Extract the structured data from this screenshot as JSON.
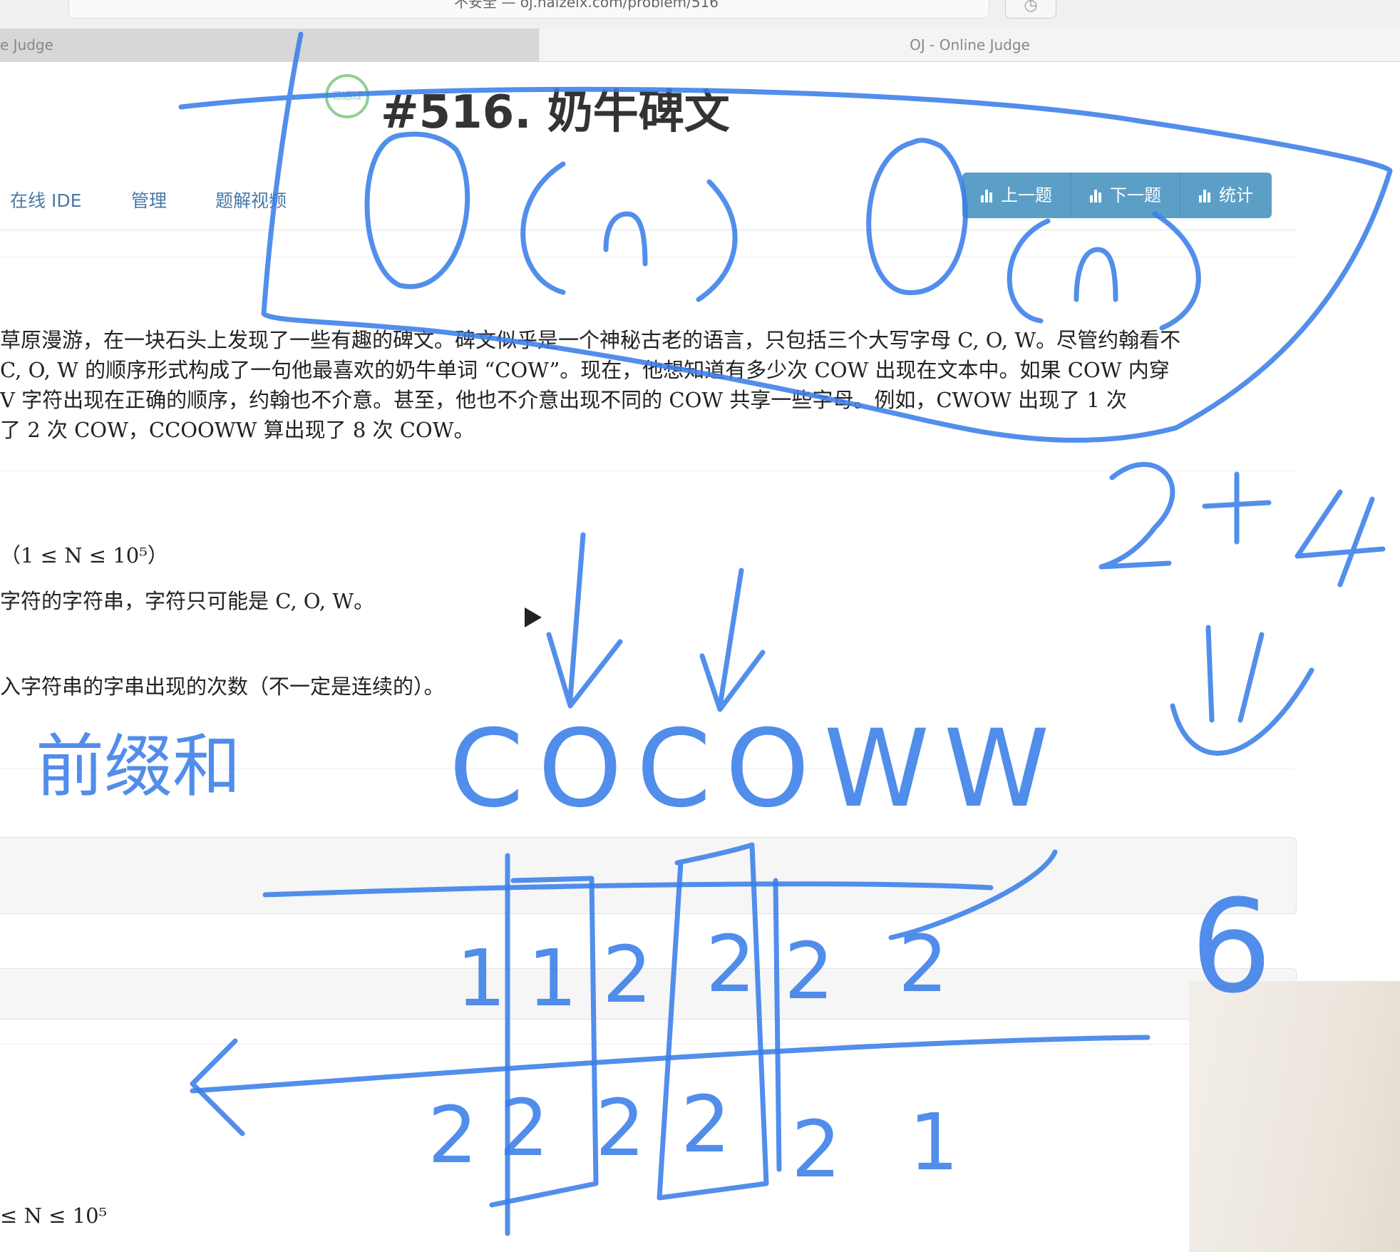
{
  "browser": {
    "url_text": "不安全 — oj.haizeix.com/problem/516",
    "reload_icon": "reload-icon",
    "history_icon": "history-icon",
    "tabs": [
      {
        "label": "e Judge"
      },
      {
        "label": "OJ - Online Judge"
      }
    ]
  },
  "problem": {
    "badge": "已通过",
    "title": "#516. 奶牛碑文",
    "nav": [
      "在线 IDE",
      "管理",
      "题解视频"
    ],
    "buttons": [
      "上一题",
      "下一题",
      "统计"
    ],
    "description_lines": [
      "草原漫游，在一块石头上发现了一些有趣的碑文。碑文似乎是一个神秘古老的语言，只包括三个大写字母 C, O, W。尽管约翰看不",
      "C, O, W 的顺序形式构成了一句他最喜欢的奶牛单词 “COW”。现在，他想知道有多少次 COW 出现在文本中。如果 COW 内穿",
      "V 字符出现在正确的顺序，约翰也不介意。甚至，他也不介意出现不同的 COW 共享一些字母。例如，CWOW 出现了 1 次",
      "了 2 次 COW，CCOOWW 算出现了 8 次 COW。"
    ],
    "input_constraint": "（1 ≤ N ≤ 10⁵）",
    "input_desc": "字符的字符串，字符只可能是 C, O, W。",
    "output_desc": "入字符串的字串出现的次数（不一定是连续的）。",
    "bottom_constraint": "≤ N ≤ 10⁵"
  },
  "annotations": {
    "big_o_left": "O(n)",
    "big_o_right": "O(n)",
    "sum": "2+4",
    "prefix_sum": "前缀和",
    "string": "COCOWW",
    "top_row": [
      "1",
      "1",
      "2",
      "2",
      "2",
      "2"
    ],
    "bottom_row": [
      "2",
      "2",
      "2",
      "2",
      "2",
      "1"
    ],
    "result": "6"
  }
}
